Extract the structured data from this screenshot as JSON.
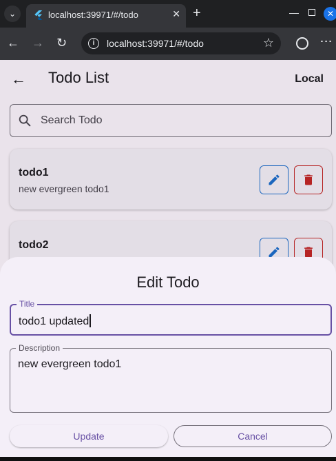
{
  "browser": {
    "tab_title": "localhost:39971/#/todo",
    "url": "localhost:39971/#/todo",
    "accent_color": "#1a73e8"
  },
  "app": {
    "title": "Todo List",
    "action_label": "Local",
    "search_placeholder": "Search Todo",
    "todos": [
      {
        "title": "todo1",
        "description": "new evergreen todo1"
      },
      {
        "title": "todo2",
        "description": ""
      }
    ],
    "colors": {
      "primary": "#6750a4",
      "edit": "#1e6fcf",
      "delete": "#c62828"
    }
  },
  "sheet": {
    "title": "Edit Todo",
    "title_field": {
      "label": "Title",
      "value": "todo1 updated"
    },
    "description_field": {
      "label": "Description",
      "value": "new evergreen todo1"
    },
    "update_label": "Update",
    "cancel_label": "Cancel"
  }
}
